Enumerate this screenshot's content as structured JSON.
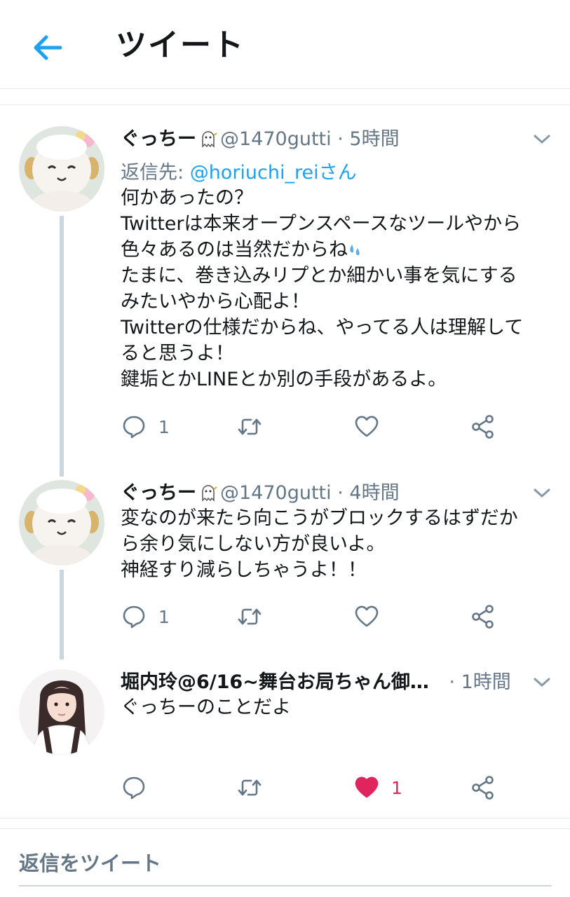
{
  "header": {
    "title": "ツイート"
  },
  "tweets": [
    {
      "name": "ぐっちー",
      "handle": "@1470gutti",
      "time": "· 5時間",
      "reply_prefix": "返信先: ",
      "reply_user": "@horiuchi_reiさん",
      "text": "何かあったの？\nTwitterは本来オープンスペースなツールやから\n色々あるのは当然だからね",
      "text2": "\nたまに、巻き込みリプとか細かい事を気にする\nみたいやから心配よ！\nTwitterの仕様だからね、やってる人は理解して\nると思うよ！\n鍵垢とかLINEとか別の手段があるよ。",
      "reply_count": "1"
    },
    {
      "name": "ぐっちー",
      "handle": "@1470gutti",
      "time": "· 4時間",
      "text": "変なのが来たら向こうがブロックするはずだか\nら余り気にしない方が良いよ。\n神経すり減らしちゃうよ！！",
      "reply_count": "1"
    },
    {
      "name": "堀内玲@6/16~舞台お局ちゃん御…",
      "time": "· 1時間",
      "text": "ぐっちーのことだよ",
      "like_count": "1"
    }
  ],
  "compose": {
    "placeholder": "返信をツイート"
  },
  "colors": {
    "accent": "#1da1f2",
    "like": "#e0245e",
    "muted": "#657786",
    "thread": "#ccd6dd"
  },
  "icons": [
    "back-arrow-icon",
    "chevron-down-icon",
    "reply-icon",
    "retweet-icon",
    "like-icon",
    "share-icon",
    "ghost-emoji-icon",
    "sweat-drop-emoji-icon"
  ]
}
